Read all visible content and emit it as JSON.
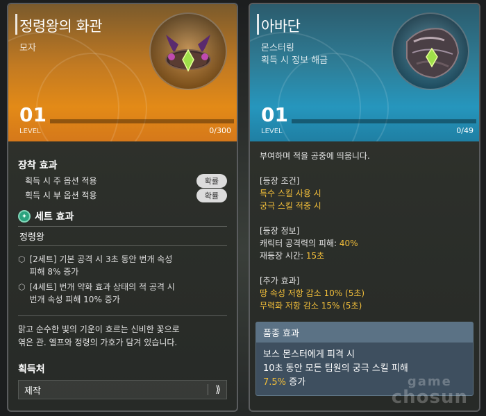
{
  "left_card": {
    "title": "정령왕의 화관",
    "type": "모자",
    "level": "01",
    "level_label": "LEVEL",
    "level_count": "0/300",
    "level_progress": 0,
    "equip_effect_title": "장착 효과",
    "options": [
      {
        "label": "획득 시 주 옵션 적용",
        "button": "확률"
      },
      {
        "label": "획득 시 부 옵션 적용",
        "button": "확률"
      }
    ],
    "set_title": "세트 효과",
    "set_name": "정령왕",
    "set_items": [
      {
        "line1": "[2세트] 기본 공격 시 3초 동안 번개 속성",
        "line2": "피해 8% 증가"
      },
      {
        "line1": "[4세트] 번개 약화 효과 상태의 적 공격 시",
        "line2": "번개 속성 피해 10% 증가"
      }
    ],
    "description_line1": "맑고 순수한 빛의 기운이 흐르는 신비한 꽃으로",
    "description_line2": "엮은 관. 엘프와 정령의 가호가 담겨 있습니다.",
    "acquire_title": "획득처",
    "acquire_value": "제작",
    "acquire_arrow": "⟫"
  },
  "right_card": {
    "title": "아바단",
    "type": "몬스터링",
    "note": "획득 시 정보 해금",
    "level": "01",
    "level_label": "LEVEL",
    "level_count": "0/49",
    "level_progress": 0,
    "summary": "부여하며 적을 공중에 띄웁니다.",
    "appear_cond_title": "[등장 조건]",
    "appear_cond": [
      "특수 스킬 사용 시",
      "궁극 스킬 적중 시"
    ],
    "appear_info_title": "[등장 정보]",
    "appear_info": [
      {
        "label": "캐릭터 공격력의 피해: ",
        "value": "40%"
      },
      {
        "label": "재등장 시간: ",
        "value": "15초"
      }
    ],
    "extra_title": "[추가 효과]",
    "extra": [
      "땅 속성 저항 감소 10% (5초)",
      "무력화 저항 감소 15% (5초)"
    ],
    "breed_title": "품종 효과",
    "breed_line1": "보스 몬스터에게 피격 시",
    "breed_line2": "10초 동안 모든 팀원의 궁극 스킬 피해",
    "breed_value": "7.5%",
    "breed_tail": " 증가"
  },
  "watermark": {
    "line1": "game",
    "line2": "chosun"
  },
  "colors": {
    "gold": "#f3bf3a",
    "orange_header": "#e38a17",
    "blue_header": "#2696bd"
  }
}
